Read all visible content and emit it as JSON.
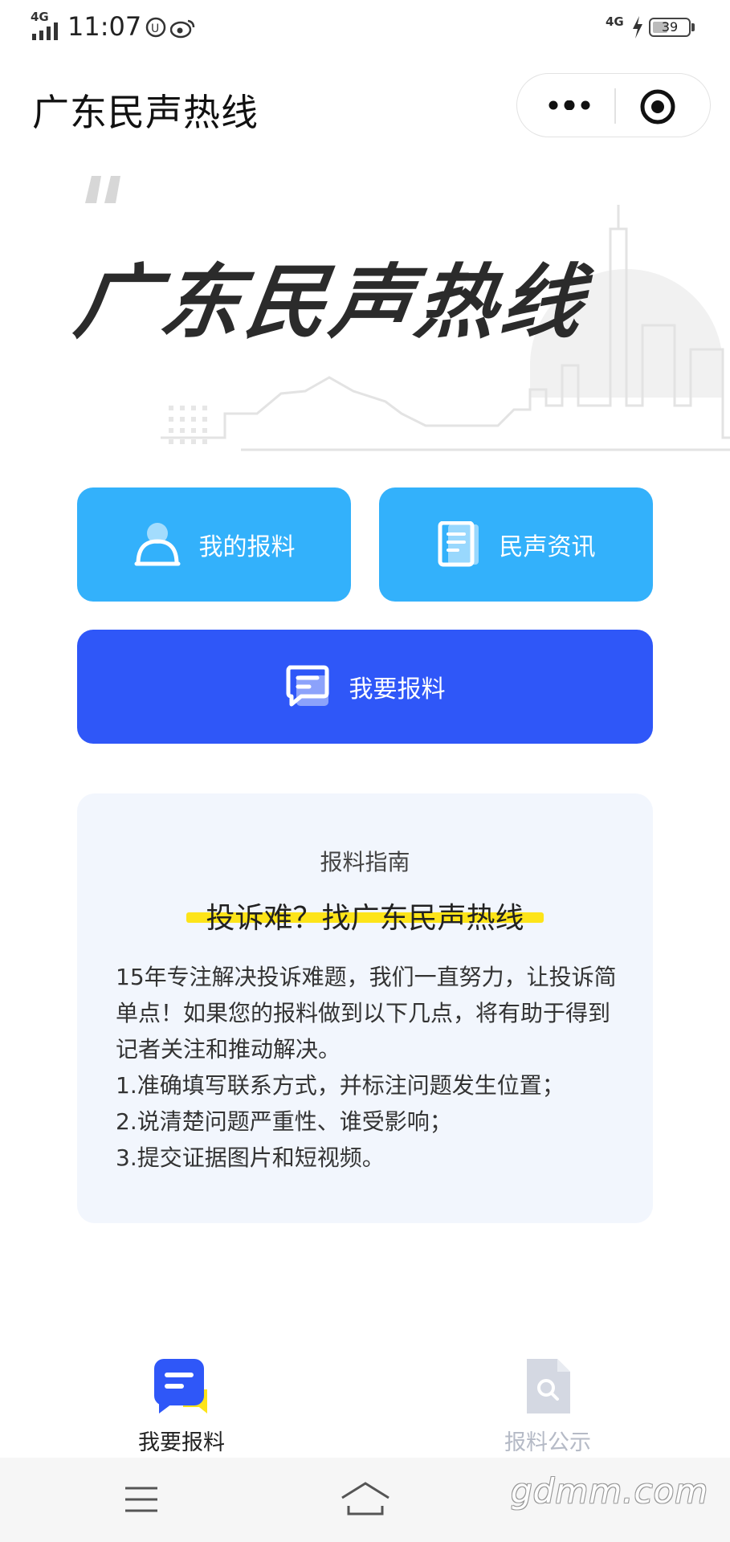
{
  "status_bar": {
    "time": "11:07",
    "network": "4G",
    "network_right": "4G",
    "battery": "39"
  },
  "title_bar": {
    "title": "广东民声热线"
  },
  "banner": {
    "title": "广东民声热线"
  },
  "actions": {
    "my_reports": "我的报料",
    "news": "民声资讯",
    "submit_report": "我要报料"
  },
  "guide": {
    "heading": "报料指南",
    "title": "投诉难？找广东民声热线",
    "paragraphs": [
      "15年专注解决投诉难题，我们一直努力，让投诉简单点！如果您的报料做到以下几点，将有助于得到记者关注和推动解决。",
      "1.准确填写联系方式，并标注问题发生位置；",
      "2.说清楚问题严重性、谁受影响；",
      "3.提交证据图片和短视频。"
    ]
  },
  "tabs": [
    {
      "label": "我要报料",
      "active": true,
      "icon": "report-chat-icon"
    },
    {
      "label": "报料公示",
      "active": false,
      "icon": "document-search-icon"
    }
  ],
  "watermark": "gdmm.com",
  "colors": {
    "light_button": "#33b1fb",
    "dark_button": "#2f57f8",
    "highlight": "#fde419",
    "tab_active": "#2f57f8",
    "tab_inactive": "#b5bac6"
  }
}
